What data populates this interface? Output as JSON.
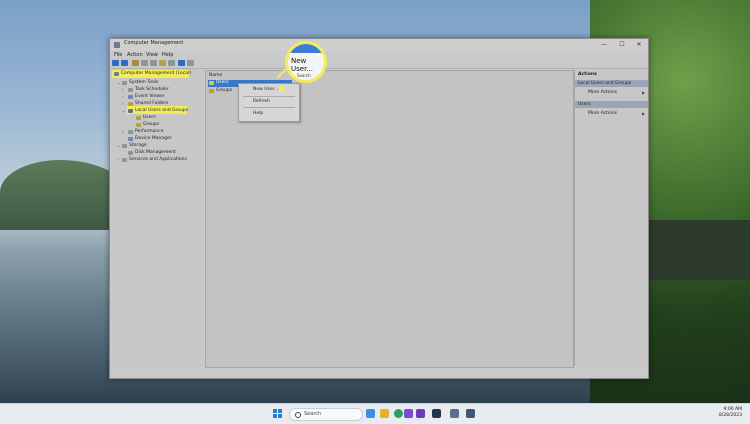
{
  "window": {
    "title": "Computer Management",
    "controls": [
      "—",
      "☐",
      "✕"
    ]
  },
  "menu": [
    "File",
    "Action",
    "View",
    "Help"
  ],
  "tree": {
    "root": "Computer Management (Local)",
    "system_tools": "System Tools",
    "task_scheduler": "Task Scheduler",
    "event_viewer": "Event Viewer",
    "shared_folders": "Shared Folders",
    "local_users_groups": "Local Users and Groups",
    "users": "Users",
    "groups": "Groups",
    "performance": "Performance",
    "device_manager": "Device Manager",
    "storage": "Storage",
    "disk_management": "Disk Management",
    "services_apps": "Services and Applications"
  },
  "content": {
    "column_name": "Name",
    "rows": [
      "Users",
      "Groups"
    ]
  },
  "context_menu": {
    "new_user": "New User...",
    "refresh": "Refresh",
    "help": "Help"
  },
  "callout": {
    "label": "New User...",
    "sub": "Search"
  },
  "actions": {
    "header": "Actions",
    "section1": "Local Users and Groups",
    "more1": "More Actions",
    "section2": "Users",
    "more2": "More Actions"
  },
  "taskbar": {
    "search_placeholder": "Search",
    "time": "9:00 AM",
    "date": "8/28/2023"
  },
  "colors": {
    "highlight": "#f3ec58",
    "selection": "#3a77c9",
    "accent": "#2a7bd6"
  }
}
